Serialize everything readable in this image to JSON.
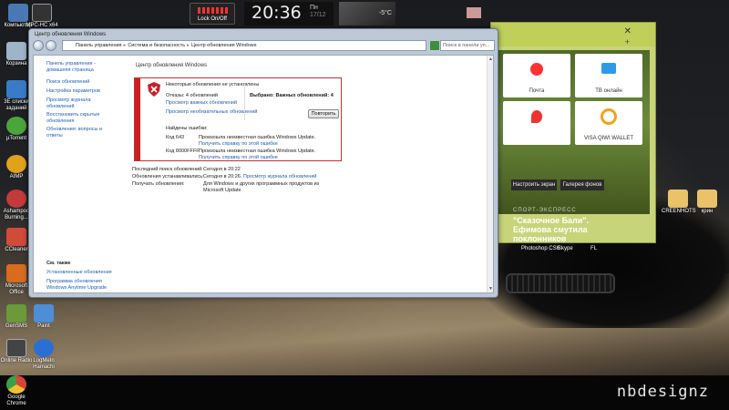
{
  "gadgets": {
    "lock_label": "Lock On/Off",
    "clock_time": "20:36",
    "clock_day": "Пн",
    "clock_date": "17/12",
    "weather_temp": "-5°C"
  },
  "desktop_icons": [
    {
      "label": "Компьютер",
      "color": "#4a78b5"
    },
    {
      "label": "Корзина",
      "color": "#9fb3c9"
    },
    {
      "label": "3E списки заданий",
      "color": "#3a7bc8"
    },
    {
      "label": "µTorrent",
      "color": "#4aa63a"
    },
    {
      "label": "AIMP",
      "color": "#e0a21a"
    },
    {
      "label": "Ashampoo Burning...",
      "color": "#c23a3a"
    },
    {
      "label": "CCleaner",
      "color": "#d24a3a"
    },
    {
      "label": "Microsoft Office",
      "color": "#d86b1e"
    },
    {
      "label": "GenSMS",
      "color": "#6a9a3a"
    },
    {
      "label": "Paint",
      "color": "#4d8ed6"
    },
    {
      "label": "Online Radio",
      "color": "#444444"
    },
    {
      "label": "LogMeIn Hamachi",
      "color": "#2c6fd4"
    },
    {
      "label": "Google Chrome",
      "color": "#d9443a"
    }
  ],
  "top_icon": {
    "label": "MPC-HC x64"
  },
  "right_icons": [
    {
      "label": "CREENHOTS"
    },
    {
      "label": "крин"
    }
  ],
  "browser": {
    "tiles": [
      {
        "label": "Почта"
      },
      {
        "label": "ТВ онлайн"
      },
      {
        "label": ""
      },
      {
        "label": "VISA QIWI WALLET"
      }
    ],
    "buttons": [
      "Настроить экран",
      "Галерея фонов"
    ],
    "news_kicker": "СПОРТ-ЭКСПРЕСС",
    "news_headline": "\"Сказочное Бали\". Ефимова смутила поклонников",
    "quick_links": [
      "Photoshop CS6",
      "Skype",
      "FL"
    ]
  },
  "window": {
    "title": "Центр обновления Windows",
    "breadcrumb": [
      "Панель управления",
      "Система и безопасность",
      "Центр обновления Windows"
    ],
    "search_placeholder": "Поиск в панели уп...",
    "sidebar": {
      "links": [
        "Панель управления - домашняя страница",
        "Поиск обновлений",
        "Настройка параметров",
        "Просмотр журнала обновлений",
        "Восстановить скрытые обновления",
        "Обновления: вопросы и ответы"
      ],
      "see_also_heading": "См. также",
      "see_also_links": [
        "Установленные обновления",
        "Программа обновления Windows Anytime Upgrade"
      ]
    },
    "main": {
      "heading": "Центр обновления Windows",
      "alert": {
        "title": "Некоторые обновления не установлены",
        "failures": "Отказы: 4 обновлений",
        "link_important": "Просмотр важных обновлений",
        "link_optional": "Просмотр необязательных обновлений",
        "selected": "Выбрано: Важных обновлений: 4",
        "retry_button": "Повторить",
        "errors_found": "Найдены ошибки:",
        "errors": [
          {
            "code": "Код 643",
            "message": "Произошла неизвестная ошибка Windows Update.",
            "help": "Получить справку по этой ошибке"
          },
          {
            "code": "Код 8000FFFF",
            "message": "Произошла неизвестная ошибка Windows Update.",
            "help": "Получить справку по этой ошибке"
          }
        ]
      },
      "info": [
        {
          "label": "Последний поиск обновлений:",
          "value": "Сегодня в 20:22",
          "link": ""
        },
        {
          "label": "Обновления устанавливались:",
          "value": "Сегодня в 20:26.",
          "link": "Просмотр журнала обновлений"
        },
        {
          "label": "Получать обновления:",
          "value": "Для Windows и других программных продуктов из Microsoft Update",
          "link": ""
        }
      ]
    }
  },
  "brand": "nbdesignz"
}
